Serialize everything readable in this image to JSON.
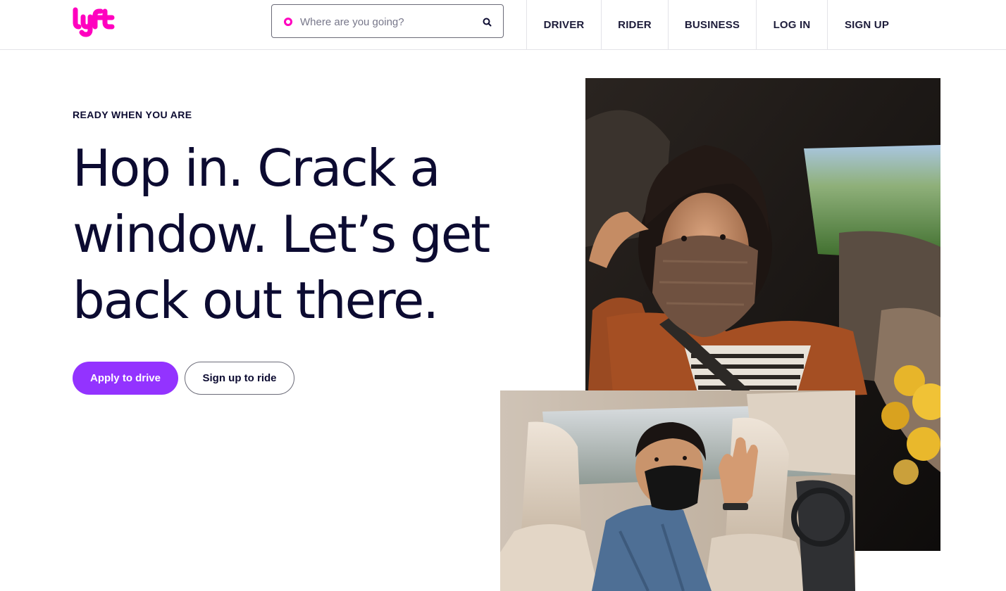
{
  "header": {
    "logo_text": "lyft",
    "search": {
      "placeholder": "Where are you going?",
      "value": ""
    },
    "nav": {
      "driver": "DRIVER",
      "rider": "RIDER",
      "business": "BUSINESS",
      "log_in": "LOG IN",
      "sign_up": "SIGN UP"
    }
  },
  "hero": {
    "eyebrow": "READY WHEN YOU ARE",
    "headline_lines": [
      "Hop in. Crack a",
      "window. Let’s get",
      "back out there."
    ],
    "primary_button": "Apply to drive",
    "secondary_button": "Sign up to ride"
  },
  "colors": {
    "brand_pink": "#ff00bf",
    "primary_purple": "#9333ff",
    "text_navy": "#0c0b31",
    "divider": "#e3e3e8"
  },
  "icons": {
    "logo": "lyft-logo",
    "search_dot": "pickup-dot-icon",
    "search_button": "search-icon"
  },
  "images": {
    "rider_photo": "woman-in-mask-riding-in-car",
    "driver_photo": "masked-driver-waving"
  }
}
